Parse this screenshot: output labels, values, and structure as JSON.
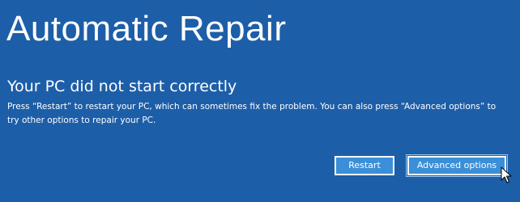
{
  "screen": {
    "background_color": "#1d5ea8",
    "title": "Automatic Repair",
    "subtitle": "Your PC did not start correctly",
    "message": "Press “Restart” to restart your PC, which can sometimes fix the problem. You can also press “Advanced options” to try other options to repair your PC."
  },
  "buttons": {
    "restart_label": "Restart",
    "advanced_label": "Advanced options",
    "button_color": "#3a8fd8"
  },
  "cursor": {
    "icon": "mouse-pointer-icon"
  }
}
